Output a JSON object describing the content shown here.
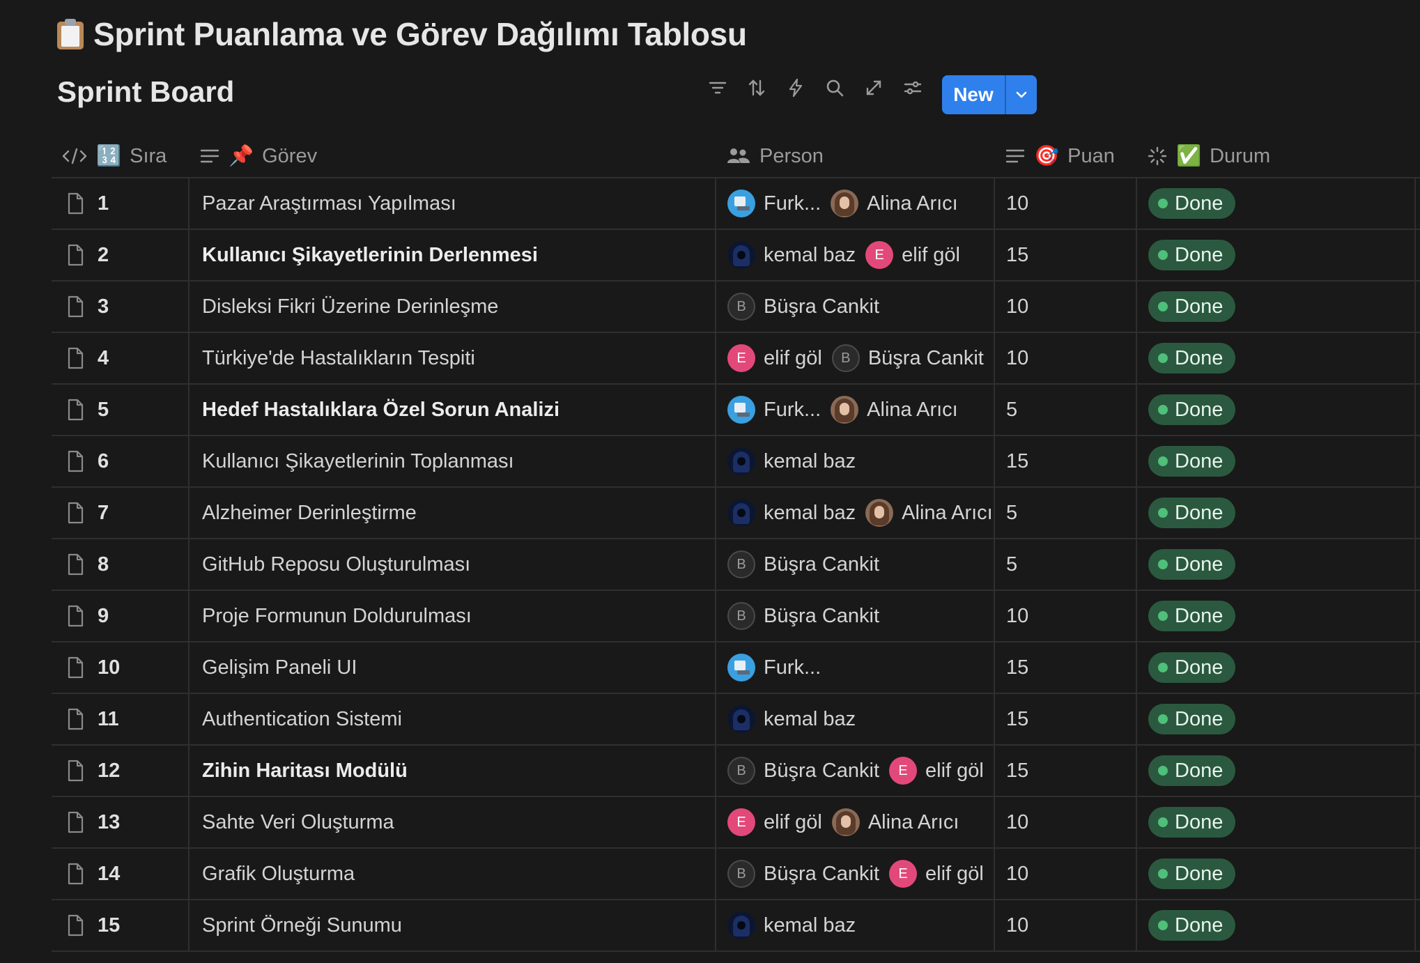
{
  "page": {
    "title": "Sprint Puanlama ve Görev Dağılımı Tablosu",
    "icon": "clipboard-icon"
  },
  "board": {
    "title": "Sprint Board"
  },
  "toolbar": {
    "tools": [
      "filter-icon",
      "sort-icon",
      "automation-bolt-icon",
      "search-icon",
      "expand-icon",
      "settings-sliders-icon"
    ],
    "new_label": "New"
  },
  "columns": {
    "sira": "Sıra",
    "sira_emoji": "🔢",
    "gorev": "Görev",
    "gorev_emoji": "📌",
    "person": "Person",
    "puan": "Puan",
    "puan_emoji": "🎯",
    "durum": "Durum",
    "durum_emoji": "✅"
  },
  "status_colors": {
    "done_bg": "#2b593f",
    "done_dot": "#4fbf7a"
  },
  "rows": [
    {
      "sira": "1",
      "gorev": "Pazar Araştırması Yapılması",
      "bold": false,
      "persons": [
        {
          "name": "Furk...",
          "avatar": "furk"
        },
        {
          "name": "Alina Arıcı",
          "avatar": "alina"
        }
      ],
      "puan": "10",
      "durum": "Done"
    },
    {
      "sira": "2",
      "gorev": "Kullanıcı Şikayetlerinin Derlenmesi",
      "bold": true,
      "persons": [
        {
          "name": "kemal baz",
          "avatar": "kemal"
        },
        {
          "name": "elif göl",
          "avatar": "elif",
          "initial": "E"
        }
      ],
      "puan": "15",
      "durum": "Done"
    },
    {
      "sira": "3",
      "gorev": "Disleksi Fikri Üzerine Derinleşme",
      "bold": false,
      "persons": [
        {
          "name": "Büşra Cankit",
          "avatar": "busra",
          "initial": "B"
        }
      ],
      "puan": "10",
      "durum": "Done"
    },
    {
      "sira": "4",
      "gorev": "Türkiye'de Hastalıkların Tespiti",
      "bold": false,
      "persons": [
        {
          "name": "elif göl",
          "avatar": "elif",
          "initial": "E"
        },
        {
          "name": "Büşra Cankit",
          "avatar": "busra",
          "initial": "B"
        }
      ],
      "puan": "10",
      "durum": "Done"
    },
    {
      "sira": "5",
      "gorev": "Hedef Hastalıklara Özel Sorun Analizi",
      "bold": true,
      "persons": [
        {
          "name": "Furk...",
          "avatar": "furk"
        },
        {
          "name": "Alina Arıcı",
          "avatar": "alina"
        }
      ],
      "puan": "5",
      "durum": "Done"
    },
    {
      "sira": "6",
      "gorev": "Kullanıcı Şikayetlerinin Toplanması",
      "bold": false,
      "persons": [
        {
          "name": "kemal baz",
          "avatar": "kemal"
        }
      ],
      "puan": "15",
      "durum": "Done"
    },
    {
      "sira": "7",
      "gorev": "Alzheimer Derinleştirme",
      "bold": false,
      "persons": [
        {
          "name": "kemal baz",
          "avatar": "kemal"
        },
        {
          "name": "Alina Arıcı",
          "avatar": "alina"
        }
      ],
      "puan": "5",
      "durum": "Done"
    },
    {
      "sira": "8",
      "gorev": "GitHub Reposu Oluşturulması",
      "bold": false,
      "persons": [
        {
          "name": "Büşra Cankit",
          "avatar": "busra",
          "initial": "B"
        }
      ],
      "puan": "5",
      "durum": "Done"
    },
    {
      "sira": "9",
      "gorev": "Proje Formunun Doldurulması",
      "bold": false,
      "persons": [
        {
          "name": "Büşra Cankit",
          "avatar": "busra",
          "initial": "B"
        }
      ],
      "puan": "10",
      "durum": "Done"
    },
    {
      "sira": "10",
      "gorev": "Gelişim Paneli UI",
      "bold": false,
      "persons": [
        {
          "name": "Furk...",
          "avatar": "furk"
        }
      ],
      "puan": "15",
      "durum": "Done"
    },
    {
      "sira": "11",
      "gorev": "Authentication Sistemi",
      "bold": false,
      "persons": [
        {
          "name": "kemal baz",
          "avatar": "kemal"
        }
      ],
      "puan": "15",
      "durum": "Done"
    },
    {
      "sira": "12",
      "gorev": "Zihin Haritası Modülü",
      "bold": true,
      "persons": [
        {
          "name": "Büşra Cankit",
          "avatar": "busra",
          "initial": "B"
        },
        {
          "name": "elif göl",
          "avatar": "elif",
          "initial": "E"
        }
      ],
      "puan": "15",
      "durum": "Done"
    },
    {
      "sira": "13",
      "gorev": "Sahte Veri Oluşturma",
      "bold": false,
      "persons": [
        {
          "name": "elif göl",
          "avatar": "elif",
          "initial": "E"
        },
        {
          "name": "Alina Arıcı",
          "avatar": "alina"
        }
      ],
      "puan": "10",
      "durum": "Done"
    },
    {
      "sira": "14",
      "gorev": "Grafik Oluşturma",
      "bold": false,
      "persons": [
        {
          "name": "Büşra Cankit",
          "avatar": "busra",
          "initial": "B"
        },
        {
          "name": "elif göl",
          "avatar": "elif",
          "initial": "E"
        }
      ],
      "puan": "10",
      "durum": "Done"
    },
    {
      "sira": "15",
      "gorev": "Sprint Örneği Sunumu",
      "bold": false,
      "persons": [
        {
          "name": "kemal baz",
          "avatar": "kemal"
        }
      ],
      "puan": "10",
      "durum": "Done"
    }
  ]
}
